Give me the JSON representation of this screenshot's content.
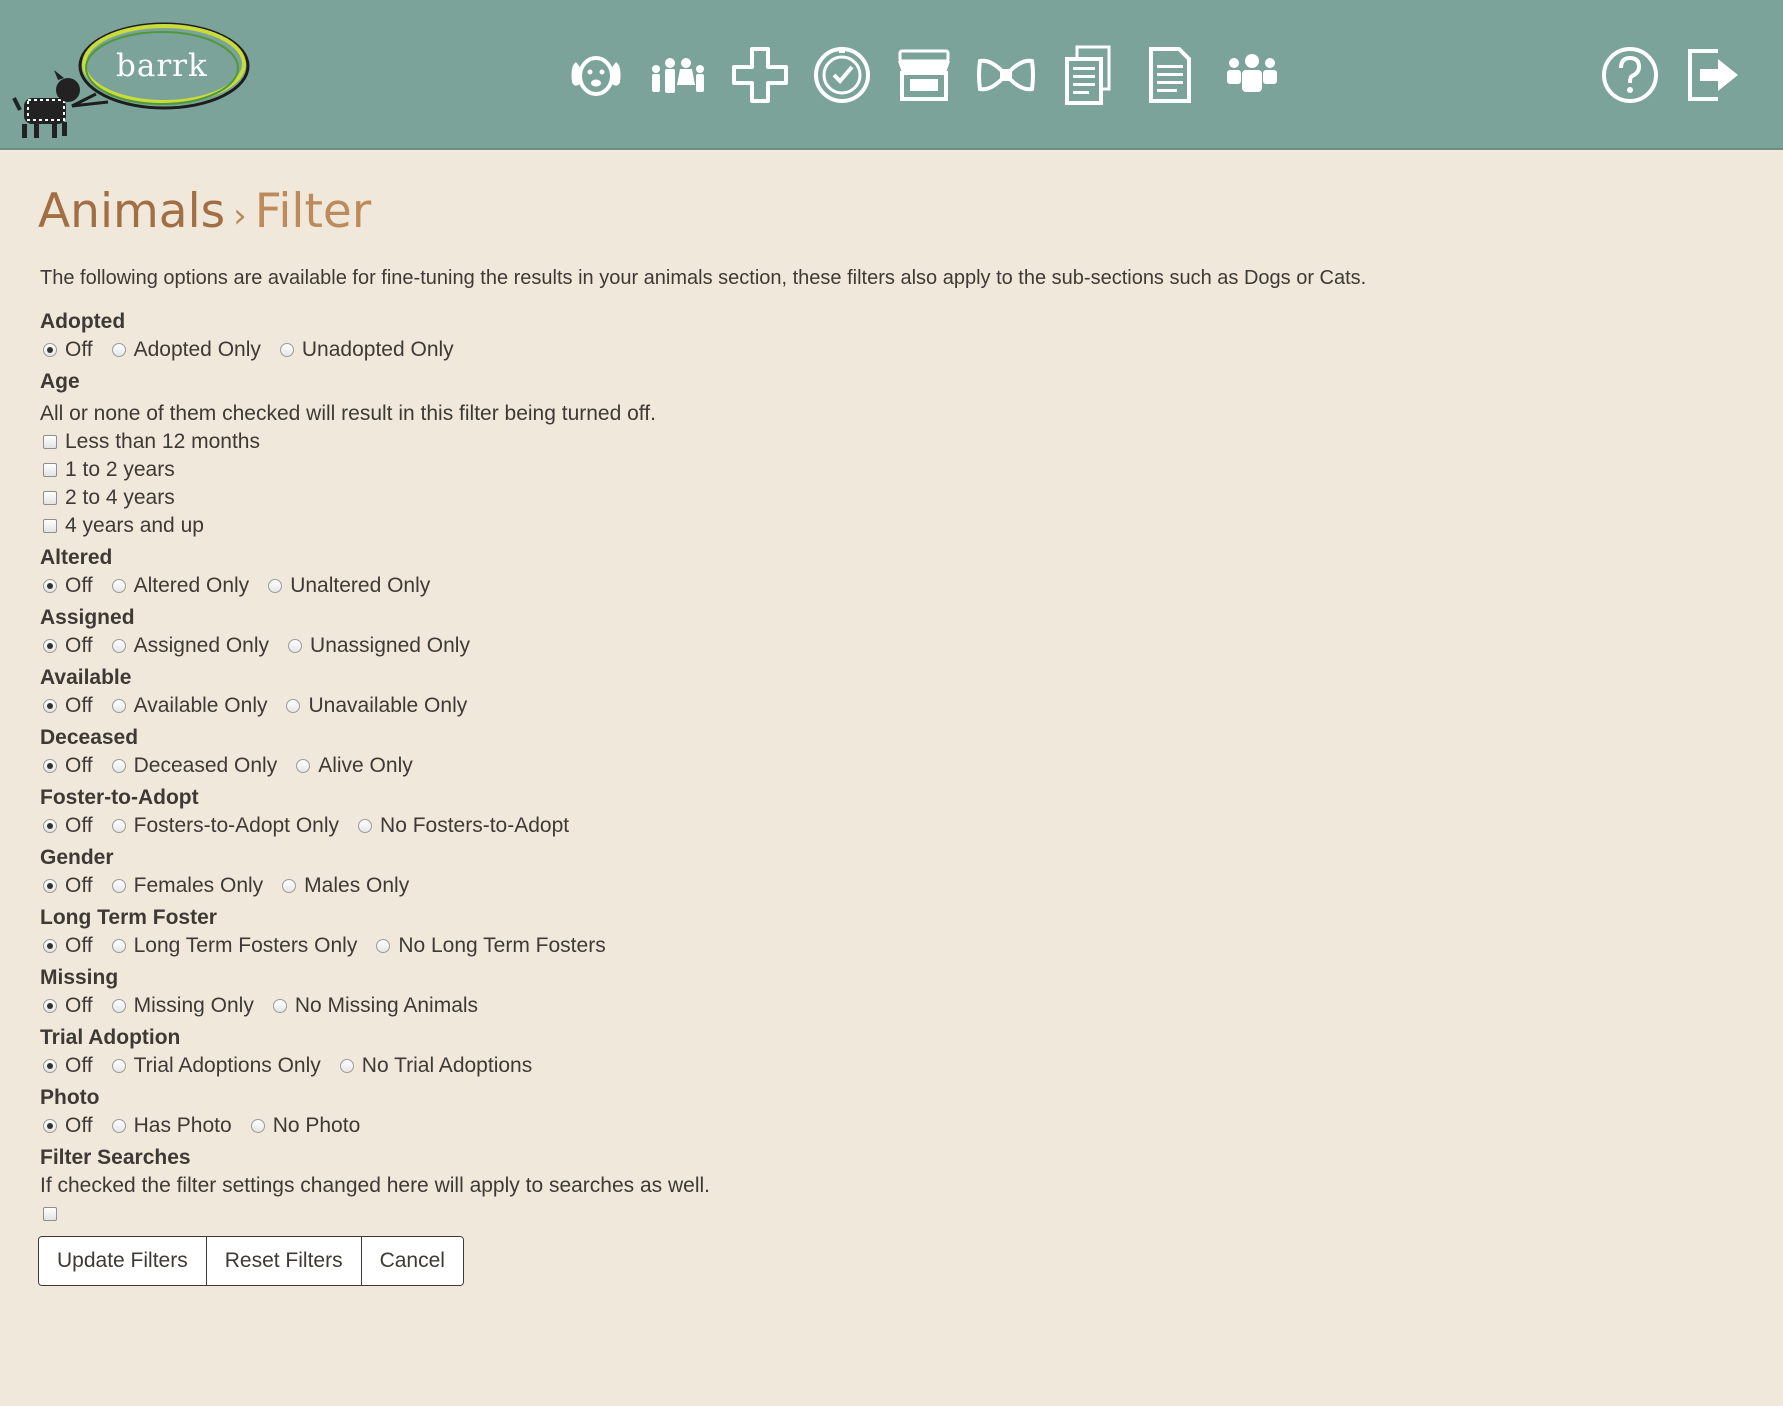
{
  "brand": {
    "logo_text": "barrk"
  },
  "nav": {
    "icons": [
      "dog-icon",
      "family-icon",
      "medical-cross-icon",
      "clock-check-icon",
      "store-icon",
      "bowtie-icon",
      "documents-icon",
      "document-icon",
      "people-group-icon"
    ],
    "right_icons": [
      "help-icon",
      "logout-icon"
    ]
  },
  "page": {
    "title": "Animals",
    "separator": "›",
    "subtitle": "Filter",
    "intro": "The following options are available for fine-tuning the results in your animals section, these filters also apply to the sub-sections such as Dogs or Cats."
  },
  "filters": {
    "adopted": {
      "label": "Adopted",
      "options": [
        "Off",
        "Adopted Only",
        "Unadopted Only"
      ],
      "selected": "Off"
    },
    "age": {
      "label": "Age",
      "note": "All or none of them checked will result in this filter being turned off.",
      "options": [
        "Less than 12 months",
        "1 to 2 years",
        "2 to 4 years",
        "4 years and up"
      ]
    },
    "altered": {
      "label": "Altered",
      "options": [
        "Off",
        "Altered Only",
        "Unaltered Only"
      ],
      "selected": "Off"
    },
    "assigned": {
      "label": "Assigned",
      "options": [
        "Off",
        "Assigned Only",
        "Unassigned Only"
      ],
      "selected": "Off"
    },
    "available": {
      "label": "Available",
      "options": [
        "Off",
        "Available Only",
        "Unavailable Only"
      ],
      "selected": "Off"
    },
    "deceased": {
      "label": "Deceased",
      "options": [
        "Off",
        "Deceased Only",
        "Alive Only"
      ],
      "selected": "Off"
    },
    "foster_to_adopt": {
      "label": "Foster-to-Adopt",
      "options": [
        "Off",
        "Fosters-to-Adopt Only",
        "No Fosters-to-Adopt"
      ],
      "selected": "Off"
    },
    "gender": {
      "label": "Gender",
      "options": [
        "Off",
        "Females Only",
        "Males Only"
      ],
      "selected": "Off"
    },
    "long_term_foster": {
      "label": "Long Term Foster",
      "options": [
        "Off",
        "Long Term Fosters Only",
        "No Long Term Fosters"
      ],
      "selected": "Off"
    },
    "missing": {
      "label": "Missing",
      "options": [
        "Off",
        "Missing Only",
        "No Missing Animals"
      ],
      "selected": "Off"
    },
    "trial_adoption": {
      "label": "Trial Adoption",
      "options": [
        "Off",
        "Trial Adoptions Only",
        "No Trial Adoptions"
      ],
      "selected": "Off"
    },
    "photo": {
      "label": "Photo",
      "options": [
        "Off",
        "Has Photo",
        "No Photo"
      ],
      "selected": "Off"
    },
    "filter_searches": {
      "label": "Filter Searches",
      "note": "If checked the filter settings changed here will apply to searches as well.",
      "checked": false
    }
  },
  "buttons": {
    "update": "Update Filters",
    "reset": "Reset Filters",
    "cancel": "Cancel"
  },
  "colors": {
    "header_bg": "#7ba39a",
    "page_bg": "#f1e8dc",
    "title": "#a26e43"
  }
}
